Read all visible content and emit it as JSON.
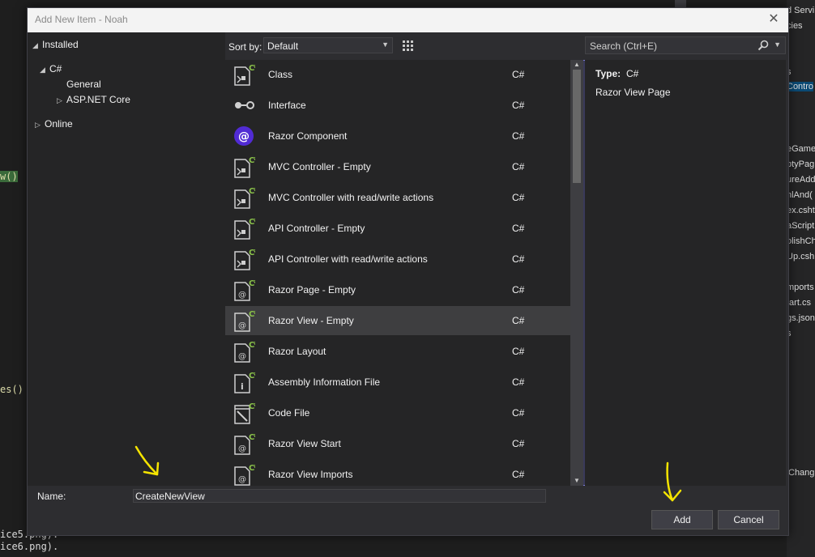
{
  "background": {
    "code_lines": [
      "w()",
      "es()"
    ],
    "bottom_lines": [
      "ice5.png).",
      "ice6.png)."
    ],
    "right_items": [
      "d Servi",
      "cies",
      "s",
      "Contro",
      "eGame",
      "ptyPag",
      "ureAdd",
      "nlAnd(",
      "ex.csht",
      "aScript",
      "olishCh",
      "Up.csh",
      "mports",
      "tart.cs",
      "gs.json",
      "s",
      "Chang"
    ]
  },
  "dialog": {
    "title": "Add New Item - Noah",
    "close_glyph": "✕",
    "tree": {
      "installed": "Installed",
      "csharp": "C#",
      "general": "General",
      "aspnet": "ASP.NET Core",
      "online": "Online"
    },
    "sort": {
      "label": "Sort by:",
      "value": "Default"
    },
    "search": {
      "placeholder": "Search (Ctrl+E)"
    },
    "templates": [
      {
        "name": "Class",
        "lang": "C#",
        "icon": "class-icon"
      },
      {
        "name": "Interface",
        "lang": "C#",
        "icon": "interface-icon"
      },
      {
        "name": "Razor Component",
        "lang": "C#",
        "icon": "razor-component-icon"
      },
      {
        "name": "MVC Controller - Empty",
        "lang": "C#",
        "icon": "controller-icon"
      },
      {
        "name": "MVC Controller with read/write actions",
        "lang": "C#",
        "icon": "controller-icon"
      },
      {
        "name": "API Controller - Empty",
        "lang": "C#",
        "icon": "controller-icon"
      },
      {
        "name": "API Controller with read/write actions",
        "lang": "C#",
        "icon": "controller-icon"
      },
      {
        "name": "Razor Page - Empty",
        "lang": "C#",
        "icon": "razor-page-icon"
      },
      {
        "name": "Razor View - Empty",
        "lang": "C#",
        "icon": "razor-view-icon",
        "selected": true
      },
      {
        "name": "Razor Layout",
        "lang": "C#",
        "icon": "razor-layout-icon"
      },
      {
        "name": "Assembly Information File",
        "lang": "C#",
        "icon": "assembly-info-icon"
      },
      {
        "name": "Code File",
        "lang": "C#",
        "icon": "code-file-icon"
      },
      {
        "name": "Razor View Start",
        "lang": "C#",
        "icon": "razor-view-start-icon"
      },
      {
        "name": "Razor View Imports",
        "lang": "C#",
        "icon": "razor-view-imports-icon"
      }
    ],
    "details": {
      "type_label": "Type:",
      "type_value": "C#",
      "description": "Razor View Page"
    },
    "name_field": {
      "label": "Name:",
      "value": "CreateNewView"
    },
    "buttons": {
      "add": "Add",
      "cancel": "Cancel"
    },
    "colors": {
      "accent": "#7a7ad6",
      "csharp_badge": "#8bc34a",
      "annotation": "#f5e400",
      "razor": "#512bd4"
    }
  }
}
